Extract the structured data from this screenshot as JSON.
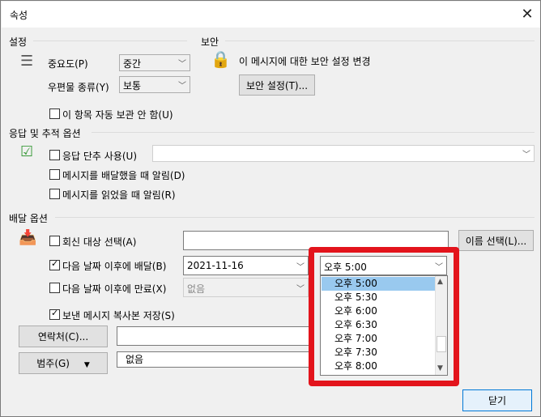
{
  "window": {
    "title": "속성",
    "close_glyph": "✕"
  },
  "settings": {
    "section": "설정",
    "importance_label": "중요도(P)",
    "importance_value": "중간",
    "sensitivity_label": "우편물 종류(Y)",
    "sensitivity_value": "보통",
    "no_autoarchive_label": "이 항목 자동 보관 안 함(U)"
  },
  "security": {
    "section": "보안",
    "change_label": "이 메시지에 대한 보안 설정 변경",
    "button": "보안 설정(T)..."
  },
  "voting": {
    "section": "응답 및 추적 옵션",
    "use_voting": "응답 단추 사용(U)",
    "voting_value": "",
    "delivered_receipt": "메시지를 배달했을 때 알림(D)",
    "read_receipt": "메시지를 읽었을 때 알림(R)"
  },
  "delivery": {
    "section": "배달 옵션",
    "have_replies": "회신 대상 선택(A)",
    "have_replies_value": "",
    "select_names": "이름 선택(L)...",
    "do_not_deliver": "다음 날짜 이후에 배달(B)",
    "deliver_date": "2021-11-16",
    "deliver_time": "오후 5:00",
    "expires": "다음 날짜 이후에 만료(X)",
    "expires_value": "없음",
    "save_copy": "보낸 메시지 복사본 저장(S)"
  },
  "time_list": [
    "오후 5:00",
    "오후 5:30",
    "오후 6:00",
    "오후 6:30",
    "오후 7:00",
    "오후 7:30",
    "오후 8:00"
  ],
  "contacts": {
    "button": "연락처(C)...",
    "value": ""
  },
  "categories": {
    "button": "범주(G)",
    "value": "없음"
  },
  "footer": {
    "close_button": "닫기"
  },
  "scroll": {
    "up": "▲",
    "down": "▼"
  },
  "arrows": {
    "down": "﹀"
  },
  "colors": {
    "highlight": "#e3141c",
    "selected": "#99c9ef",
    "accent": "#0078d7"
  }
}
